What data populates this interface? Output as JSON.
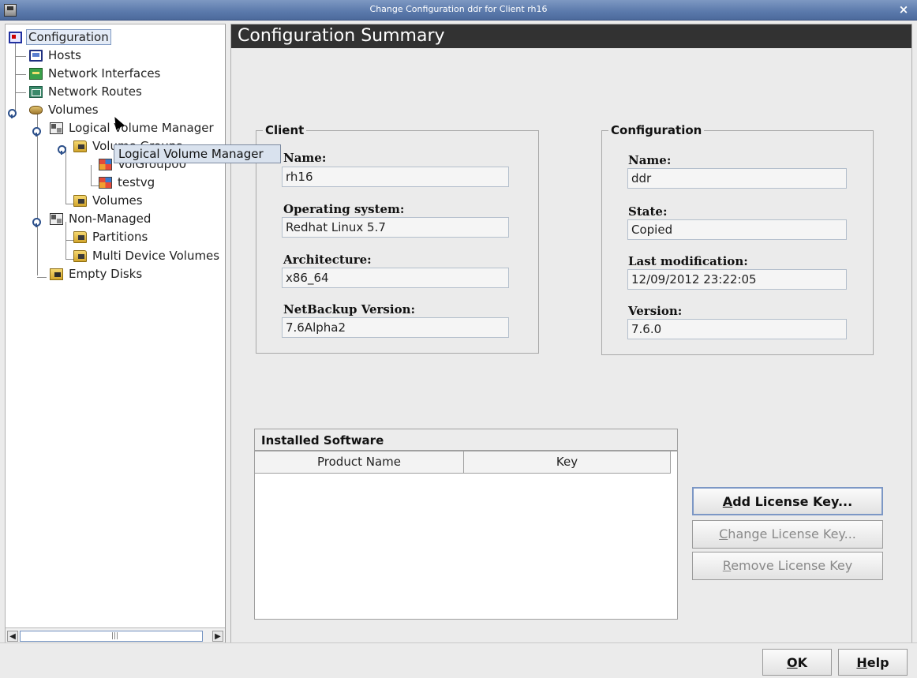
{
  "window": {
    "title": "Change Configuration ddr for Client rh16",
    "close_glyph": "×"
  },
  "tree": {
    "items": [
      {
        "label": "Configuration",
        "icon": "configuration-icon"
      },
      {
        "label": "Hosts",
        "icon": "hosts-icon"
      },
      {
        "label": "Network Interfaces",
        "icon": "network-interfaces-icon"
      },
      {
        "label": "Network Routes",
        "icon": "network-routes-icon"
      },
      {
        "label": "Volumes",
        "icon": "volumes-icon"
      },
      {
        "label": "Logical Volume Manager",
        "icon": "lvm-icon"
      },
      {
        "label": "Volume Groups",
        "icon": "folder-icon"
      },
      {
        "label": "VolGroup00",
        "icon": "volume-group-icon"
      },
      {
        "label": "testvg",
        "icon": "volume-group-icon"
      },
      {
        "label": "Volumes",
        "icon": "folder-icon"
      },
      {
        "label": "Non-Managed",
        "icon": "non-managed-icon"
      },
      {
        "label": "Partitions",
        "icon": "folder-icon"
      },
      {
        "label": "Multi Device Volumes",
        "icon": "folder-icon"
      },
      {
        "label": "Empty Disks",
        "icon": "disk-icon"
      }
    ],
    "tooltip": "Logical Volume Manager",
    "scroll_grip": "|||"
  },
  "summary": {
    "title": "Configuration Summary",
    "client": {
      "legend": "Client",
      "name_label": "Name:",
      "name_value": "rh16",
      "os_label": "Operating system:",
      "os_value": "Redhat Linux 5.7",
      "arch_label": "Architecture:",
      "arch_value": "x86_64",
      "nbv_label": "NetBackup Version:",
      "nbv_value": "7.6Alpha2"
    },
    "configuration": {
      "legend": "Configuration",
      "name_label": "Name:",
      "name_value": "ddr",
      "state_label": "State:",
      "state_value": "Copied",
      "lastmod_label": "Last modification:",
      "lastmod_value": "12/09/2012 23:22:05",
      "version_label": "Version:",
      "version_value": "7.6.0"
    },
    "software": {
      "header": "Installed Software",
      "columns": [
        "Product Name",
        "Key"
      ]
    },
    "buttons": {
      "add": {
        "mnemonic": "A",
        "rest": "dd License Key..."
      },
      "change": {
        "mnemonic": "C",
        "rest": "hange License Key..."
      },
      "remove": {
        "mnemonic": "R",
        "rest": "emove License Key"
      }
    }
  },
  "footer": {
    "ok": {
      "mnemonic": "O",
      "rest": "K"
    },
    "help": {
      "mnemonic": "H",
      "rest": "elp"
    }
  }
}
